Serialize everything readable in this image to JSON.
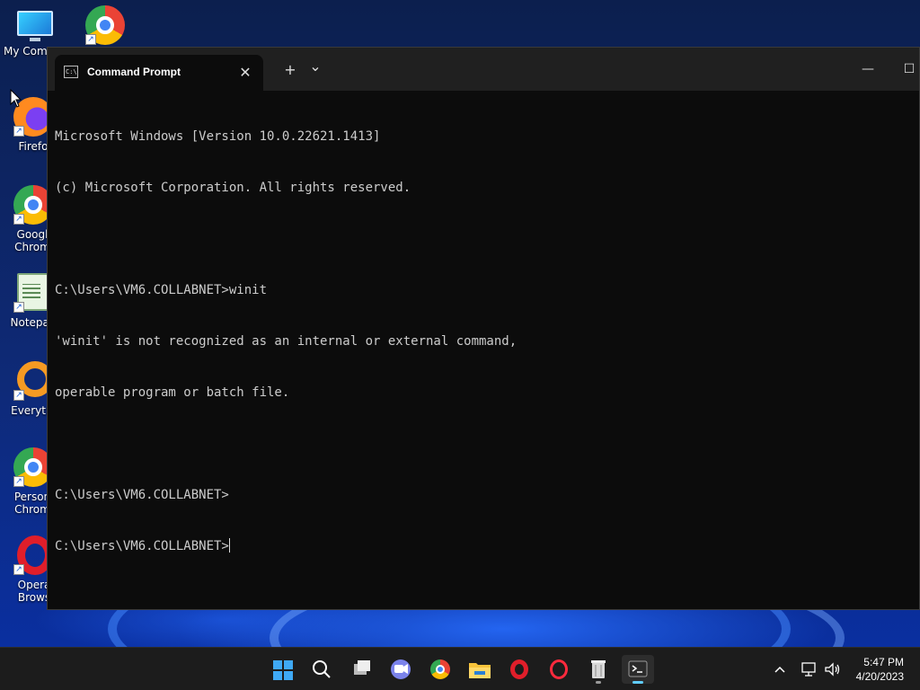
{
  "desktop": {
    "icons": [
      {
        "label": "My Comp",
        "icon": "monitor-icon"
      },
      {
        "label": "",
        "icon": "chrome-canary-icon"
      },
      {
        "label": "Firefo",
        "icon": "firefox-icon"
      },
      {
        "label": "Googl Chrom",
        "icon": "chrome-icon"
      },
      {
        "label": "Notepad",
        "icon": "notepad-icon"
      },
      {
        "label": "Everythi",
        "icon": "everything-search-icon"
      },
      {
        "label": "Person Chrom",
        "icon": "chrome-profile-icon"
      },
      {
        "label": "Opera Brows",
        "icon": "opera-icon"
      }
    ]
  },
  "window": {
    "tab_title": "Command Prompt",
    "tab_close": "✕",
    "new_tab": "+",
    "dropdown": "⌄",
    "minimize": "—",
    "maximize": "☐",
    "console_lines": [
      "Microsoft Windows [Version 10.0.22621.1413]",
      "(c) Microsoft Corporation. All rights reserved.",
      "",
      "C:\\Users\\VM6.COLLABNET>winit",
      "'winit' is not recognized as an internal or external command,",
      "operable program or batch file.",
      "",
      "C:\\Users\\VM6.COLLABNET>",
      "C:\\Users\\VM6.COLLABNET>"
    ]
  },
  "taskbar": {
    "items": [
      "start",
      "search",
      "task-view",
      "teams-chat",
      "chrome",
      "file-explorer",
      "opera",
      "opera-gx",
      "recycle-app",
      "terminal"
    ],
    "active": "terminal",
    "clock": {
      "time": "5:47 PM",
      "date": "4/20/2023"
    }
  },
  "colors": {
    "console_bg": "#0c0c0c",
    "console_fg": "#cccccc",
    "titlebar": "#202020",
    "taskbar": "#1c1c1c",
    "accent": "#60cdff"
  }
}
